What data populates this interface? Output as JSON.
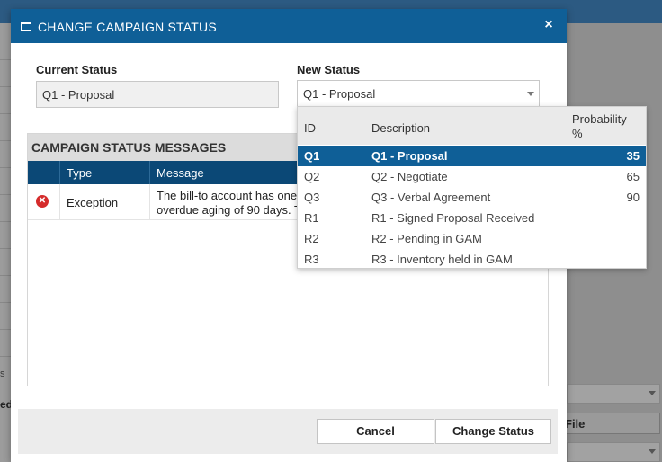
{
  "background": {
    "fragment_left_1": "s",
    "fragment_left_2": "ed",
    "file_button": "File"
  },
  "dialog": {
    "title": "CHANGE CAMPAIGN STATUS",
    "close_glyph": "×",
    "current_status": {
      "label": "Current Status",
      "value": "Q1 - Proposal"
    },
    "new_status": {
      "label": "New Status",
      "value": "Q1 - Proposal"
    },
    "messages": {
      "heading": "CAMPAIGN STATUS MESSAGES",
      "columns": [
        "Type",
        "Message"
      ],
      "rows": [
        {
          "icon": "error-icon",
          "type": "Exception",
          "message_line1": "The bill-to account has one",
          "message_line2": "overdue aging of 90 days. T"
        }
      ]
    },
    "buttons": {
      "cancel": "Cancel",
      "change_status": "Change Status"
    }
  },
  "dropdown": {
    "columns": {
      "id": "ID",
      "description": "Description",
      "probability": "Probability %"
    },
    "options": [
      {
        "id": "Q1",
        "description": "Q1 - Proposal",
        "probability": "35",
        "selected": true
      },
      {
        "id": "Q2",
        "description": "Q2 - Negotiate",
        "probability": "65",
        "selected": false
      },
      {
        "id": "Q3",
        "description": "Q3 - Verbal Agreement",
        "probability": "90",
        "selected": false
      },
      {
        "id": "R1",
        "description": "R1 - Signed Proposal Received",
        "probability": "",
        "selected": false
      },
      {
        "id": "R2",
        "description": "R2 - Pending in GAM",
        "probability": "",
        "selected": false
      },
      {
        "id": "R3",
        "description": "R3 - Inventory held in GAM",
        "probability": "",
        "selected": false
      }
    ]
  },
  "colors": {
    "header_blue": "#0f5f97",
    "grid_header_navy": "#0b4876",
    "error_red": "#d52b2b"
  }
}
